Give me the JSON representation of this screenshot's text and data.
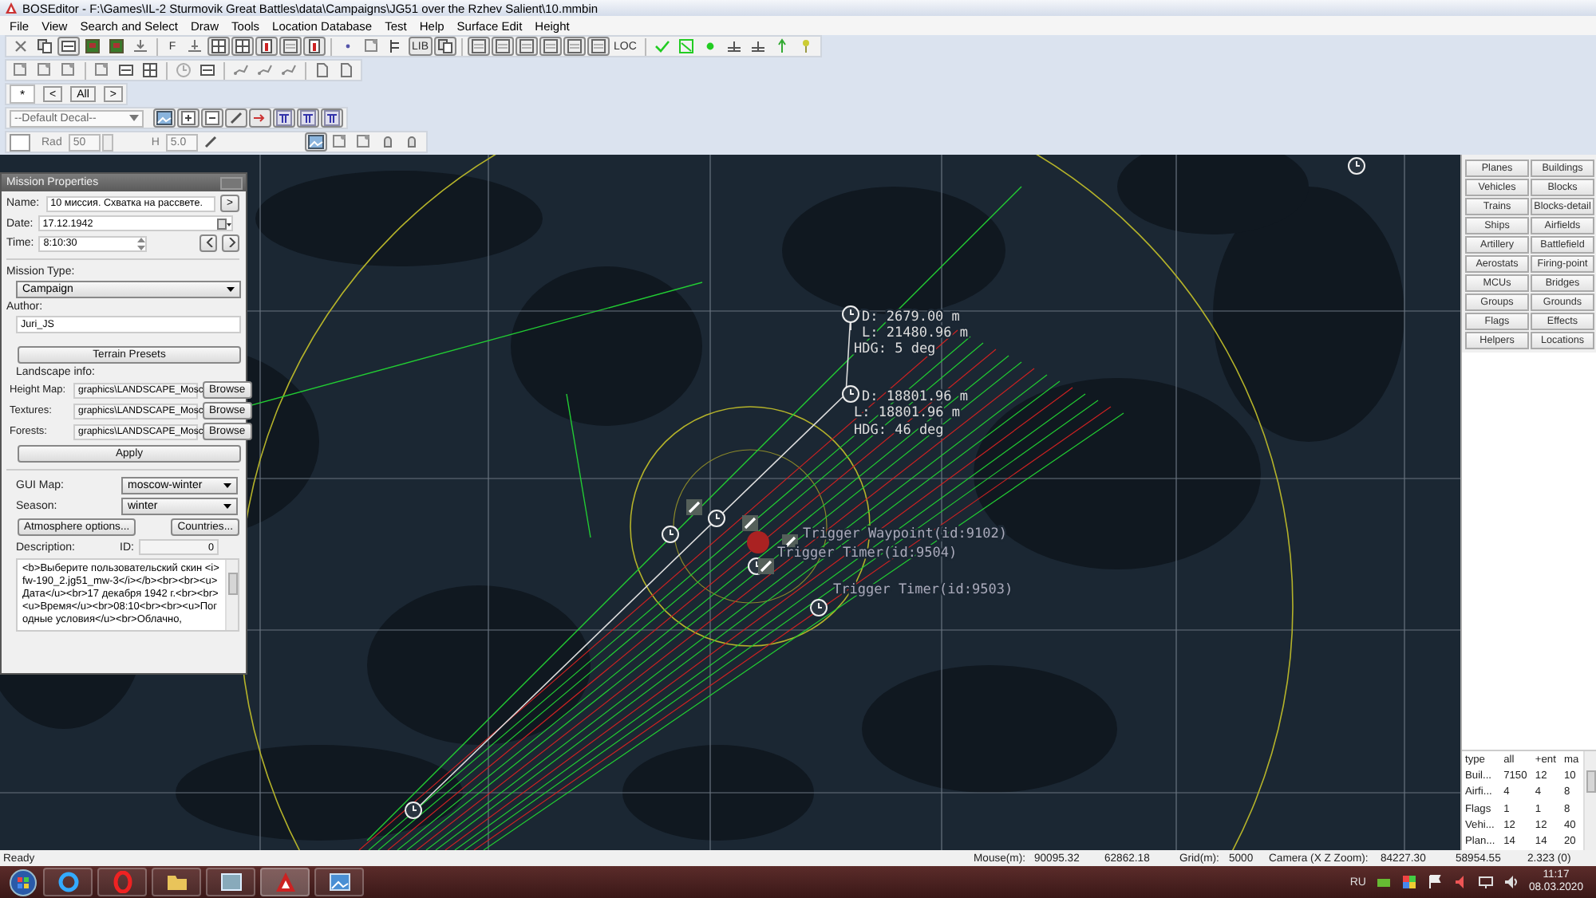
{
  "window": {
    "title": "BOSEditor - F:\\Games\\IL-2 Sturmovik Great Battles\\data\\Campaigns\\JG51 over the Rzhev Salient\\10.mmbin"
  },
  "menu": [
    "File",
    "View",
    "Search and Select",
    "Draw",
    "Tools",
    "Location Database",
    "Test",
    "Help",
    "Surface Edit",
    "Height"
  ],
  "toolbar": {
    "text_buttons": [
      "F",
      "LIB",
      "LOC"
    ]
  },
  "filter_bar": {
    "tabs": [
      {
        "label": "*",
        "selected": true
      }
    ],
    "buttons": [
      "<",
      "All",
      ">"
    ]
  },
  "decal_bar": {
    "select": "--Default Decal--"
  },
  "brush_bar": {
    "rad_label": "Rad",
    "rad_value": "50",
    "h_label": "H",
    "h_value": "5.0"
  },
  "mission_properties": {
    "title": "Mission Properties",
    "name_label": "Name:",
    "name": "10 миссия. Схватка на рассвете.",
    "name_button": ">",
    "date_label": "Date:",
    "date": "17.12.1942",
    "time_label": "Time:",
    "time": "8:10:30",
    "mission_type_label": "Mission Type:",
    "mission_type": "Campaign",
    "author_label": "Author:",
    "author": "Juri_JS",
    "terrain_button": "Terrain Presets",
    "landscape_label": "Landscape info:",
    "landscape": [
      {
        "label": "Height Map:",
        "value": "graphics\\LANDSCAPE_Mosc",
        "button": "Browse"
      },
      {
        "label": "Textures:",
        "value": "graphics\\LANDSCAPE_Mosc",
        "button": "Browse"
      },
      {
        "label": "Forests:",
        "value": "graphics\\LANDSCAPE_Mosc",
        "button": "Browse"
      }
    ],
    "apply_button": "Apply",
    "gui_map_label": "GUI Map:",
    "gui_map": "moscow-winter",
    "season_label": "Season:",
    "season": "winter",
    "atmosphere_button": "Atmosphere options...",
    "countries_button": "Countries...",
    "description_label": "Description:",
    "id_label": "ID:",
    "id": "0",
    "description": "<b>Выберите пользовательский скин <i>fw-190_2.jg51_mw-3</i></b><br><br><u>Дата</u><br>17 декабря 1942 г.<br><br><u>Время</u><br>08:10<br><br><u>Погодные условия</u><br>Облачно,"
  },
  "map_labels": [
    {
      "text": "D:  2679.00 m"
    },
    {
      "text": "L:  21480.96 m"
    },
    {
      "text": "HDG:  5 deg"
    },
    {
      "text": "D:  18801.96 m"
    },
    {
      "text": "L:  18801.96 m"
    },
    {
      "text": "HDG:  46 deg"
    },
    {
      "text": "Trigger Waypoint(id:9102)"
    },
    {
      "text": "Trigger Timer(id:9504)"
    },
    {
      "text": "Trigger Timer(id:9503)"
    }
  ],
  "object_buttons": [
    "Planes",
    "Buildings",
    "Vehicles",
    "Blocks",
    "Trains",
    "Blocks-detail",
    "Ships",
    "Airfields",
    "Artillery",
    "Battlefield",
    "Aerostats",
    "Firing-point",
    "MCUs",
    "Bridges",
    "Groups",
    "Grounds",
    "Flags",
    "Effects",
    "Helpers",
    "Locations"
  ],
  "stats_table": {
    "columns": [
      "type",
      "all",
      "+ent",
      "ma"
    ],
    "rows": [
      [
        "Buil...",
        "7150",
        "12",
        "10"
      ],
      [
        "Airfi...",
        "4",
        "4",
        "8"
      ],
      [
        "Flags",
        "1",
        "1",
        "8"
      ],
      [
        "Vehi...",
        "12",
        "12",
        "40"
      ],
      [
        "Plan...",
        "14",
        "14",
        "20"
      ]
    ]
  },
  "status_bar": [
    "Ready",
    "Mouse(m):",
    "90095.32",
    "62862.18",
    "Grid(m):",
    "5000",
    "Camera (X  Z  Zoom):",
    "84227.30",
    "58954.55",
    "2.323 (0)"
  ],
  "taskbar": {
    "language": "RU",
    "time": "11:17",
    "date": "08.03.2020"
  }
}
